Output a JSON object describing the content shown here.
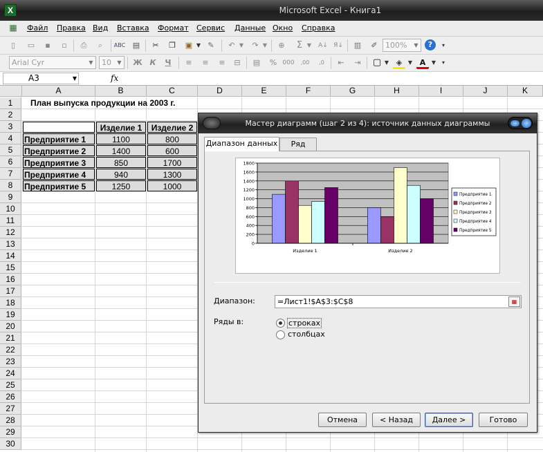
{
  "window": {
    "title": "Microsoft Excel - Книга1"
  },
  "menu": [
    "Файл",
    "Правка",
    "Вид",
    "Вставка",
    "Формат",
    "Сервис",
    "Данные",
    "Окно",
    "Справка"
  ],
  "toolbar": {
    "zoom": "100%",
    "font": "Arial Cyr",
    "size": "10",
    "bold": "Ж",
    "italic": "К",
    "underline": "Ч"
  },
  "formula_bar": {
    "name_box": "A3",
    "fx": "fx"
  },
  "sheet": {
    "columns": [
      "A",
      "B",
      "C",
      "D",
      "E",
      "F",
      "G",
      "H",
      "I",
      "J",
      "K"
    ],
    "rows": [
      "1",
      "2",
      "3",
      "4",
      "5",
      "6",
      "7",
      "8",
      "9",
      "10",
      "11",
      "12",
      "13",
      "14",
      "15",
      "16",
      "17",
      "18",
      "19",
      "20",
      "21",
      "22",
      "23",
      "24",
      "25",
      "26",
      "27",
      "28",
      "29",
      "30"
    ],
    "title": "План выпуска продукции на 2003 г.",
    "headers": [
      "Изделие 1",
      "Изделие 2"
    ],
    "data": [
      {
        "name": "Предприятие 1",
        "v1": "1100",
        "v2": "800"
      },
      {
        "name": "Предприятие 2",
        "v1": "1400",
        "v2": "600"
      },
      {
        "name": "Предприятие 3",
        "v1": "850",
        "v2": "1700"
      },
      {
        "name": "Предприятие 4",
        "v1": "940",
        "v2": "1300"
      },
      {
        "name": "Предприятие 5",
        "v1": "1250",
        "v2": "1000"
      }
    ]
  },
  "dialog": {
    "title": "Мастер диаграмм (шаг 2 из 4): источник данных диаграммы",
    "tabs": [
      "Диапазон данных",
      "Ряд"
    ],
    "range_label": "Диапазон:",
    "range_value": "=Лист1!$A$3:$C$8",
    "series_in_label": "Ряды в:",
    "radio_rows": "строках",
    "radio_cols": "столбцах",
    "buttons": {
      "cancel": "Отмена",
      "back": "< Назад",
      "next": "Далее >",
      "finish": "Готово"
    }
  },
  "chart_data": {
    "type": "bar",
    "categories": [
      "Изделие 1",
      "Изделие 2"
    ],
    "series": [
      {
        "name": "Предприятие 1",
        "values": [
          1100,
          800
        ],
        "color": "#9999ff"
      },
      {
        "name": "Предприятие 2",
        "values": [
          1400,
          600
        ],
        "color": "#993366"
      },
      {
        "name": "Предприятие 3",
        "values": [
          850,
          1700
        ],
        "color": "#ffffcc"
      },
      {
        "name": "Предприятие 4",
        "values": [
          940,
          1300
        ],
        "color": "#ccffff"
      },
      {
        "name": "Предприятие 5",
        "values": [
          1250,
          1000
        ],
        "color": "#660066"
      }
    ],
    "ylim": [
      0,
      1800
    ],
    "yticks": [
      0,
      200,
      400,
      600,
      800,
      1000,
      1200,
      1400,
      1600,
      1800
    ],
    "grid": true,
    "legend": "right",
    "plot_background": "#c0c0c0"
  }
}
